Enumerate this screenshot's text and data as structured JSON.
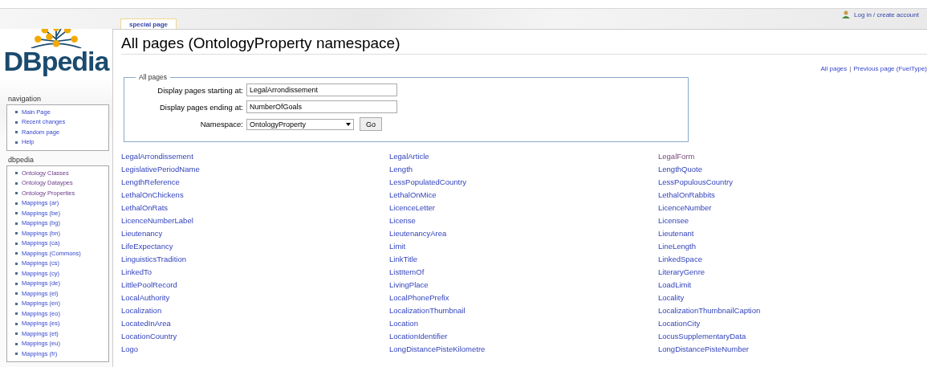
{
  "logo": {
    "text": "DBpedia"
  },
  "user_link": {
    "label": "Log in / create account"
  },
  "tab": {
    "label": "special page",
    "selected": true
  },
  "title": "All pages (OntologyProperty namespace)",
  "nav_links": [
    {
      "label": "All pages"
    },
    {
      "separator": "|"
    },
    {
      "label": "Previous page (FuelType)"
    }
  ],
  "sidebar": [
    {
      "heading": "navigation",
      "items": [
        {
          "label": "Main Page",
          "visited": false
        },
        {
          "label": "Recent changes",
          "visited": false
        },
        {
          "label": "Random page",
          "visited": false
        },
        {
          "label": "Help",
          "visited": false
        }
      ]
    },
    {
      "heading": "dbpedia",
      "items": [
        {
          "label": "Ontology Classes",
          "visited": true
        },
        {
          "label": "Ontology Dataypes",
          "visited": true
        },
        {
          "label": "Ontology Properties",
          "visited": true
        },
        {
          "label": "Mappings (ar)",
          "visited": false
        },
        {
          "label": "Mappings (be)",
          "visited": false
        },
        {
          "label": "Mappings (bg)",
          "visited": false
        },
        {
          "label": "Mappings (bn)",
          "visited": false
        },
        {
          "label": "Mappings (ca)",
          "visited": false
        },
        {
          "label": "Mappings (Commons)",
          "visited": false
        },
        {
          "label": "Mappings (cs)",
          "visited": false
        },
        {
          "label": "Mappings (cy)",
          "visited": false
        },
        {
          "label": "Mappings (de)",
          "visited": false
        },
        {
          "label": "Mappings (el)",
          "visited": false
        },
        {
          "label": "Mappings (en)",
          "visited": false
        },
        {
          "label": "Mappings (eo)",
          "visited": false
        },
        {
          "label": "Mappings (es)",
          "visited": false
        },
        {
          "label": "Mappings (et)",
          "visited": false
        },
        {
          "label": "Mappings (eu)",
          "visited": false
        },
        {
          "label": "Mappings (fr)",
          "visited": false
        }
      ]
    }
  ],
  "form": {
    "legend": "All pages",
    "fields": [
      {
        "kind": "text",
        "label": "Display pages starting at:",
        "value": "LegalArrondissement"
      },
      {
        "kind": "text",
        "label": "Display pages ending at:",
        "value": "NumberOfGoals"
      },
      {
        "kind": "select",
        "label": "Namespace:",
        "value": "OntologyProperty",
        "button": "Go"
      }
    ]
  },
  "page_list": [
    [
      {
        "label": "LegalArrondissement",
        "visited": false
      },
      {
        "label": "LegalArticle",
        "visited": false
      },
      {
        "label": "LegalForm",
        "visited": true
      }
    ],
    [
      {
        "label": "LegislativePeriodName",
        "visited": false
      },
      {
        "label": "Length",
        "visited": false
      },
      {
        "label": "LengthQuote",
        "visited": false
      }
    ],
    [
      {
        "label": "LengthReference",
        "visited": false
      },
      {
        "label": "LessPopulatedCountry",
        "visited": false
      },
      {
        "label": "LessPopulousCountry",
        "visited": false
      }
    ],
    [
      {
        "label": "LethalOnChickens",
        "visited": false
      },
      {
        "label": "LethalOnMice",
        "visited": false
      },
      {
        "label": "LethalOnRabbits",
        "visited": false
      }
    ],
    [
      {
        "label": "LethalOnRats",
        "visited": false
      },
      {
        "label": "LicenceLetter",
        "visited": false
      },
      {
        "label": "LicenceNumber",
        "visited": false
      }
    ],
    [
      {
        "label": "LicenceNumberLabel",
        "visited": false
      },
      {
        "label": "License",
        "visited": false
      },
      {
        "label": "Licensee",
        "visited": false
      }
    ],
    [
      {
        "label": "Lieutenancy",
        "visited": false
      },
      {
        "label": "LieutenancyArea",
        "visited": false
      },
      {
        "label": "Lieutenant",
        "visited": false
      }
    ],
    [
      {
        "label": "LifeExpectancy",
        "visited": false
      },
      {
        "label": "Limit",
        "visited": false
      },
      {
        "label": "LineLength",
        "visited": false
      }
    ],
    [
      {
        "label": "LinguisticsTradition",
        "visited": false
      },
      {
        "label": "LinkTitle",
        "visited": false
      },
      {
        "label": "LinkedSpace",
        "visited": false
      }
    ],
    [
      {
        "label": "LinkedTo",
        "visited": false
      },
      {
        "label": "ListItemOf",
        "visited": false
      },
      {
        "label": "LiteraryGenre",
        "visited": false
      }
    ],
    [
      {
        "label": "LittlePoolRecord",
        "visited": false
      },
      {
        "label": "LivingPlace",
        "visited": false
      },
      {
        "label": "LoadLimit",
        "visited": false
      }
    ],
    [
      {
        "label": "LocalAuthority",
        "visited": false
      },
      {
        "label": "LocalPhonePrefix",
        "visited": false
      },
      {
        "label": "Locality",
        "visited": false
      }
    ],
    [
      {
        "label": "Localization",
        "visited": false
      },
      {
        "label": "LocalizationThumbnail",
        "visited": false
      },
      {
        "label": "LocalizationThumbnailCaption",
        "visited": false
      }
    ],
    [
      {
        "label": "LocatedInArea",
        "visited": false
      },
      {
        "label": "Location",
        "visited": false
      },
      {
        "label": "LocationCity",
        "visited": false
      }
    ],
    [
      {
        "label": "LocationCountry",
        "visited": false
      },
      {
        "label": "LocationIdentifier",
        "visited": false
      },
      {
        "label": "LocusSupplementaryData",
        "visited": false
      }
    ],
    [
      {
        "label": "Logo",
        "visited": false
      },
      {
        "label": "LongDistancePisteKilometre",
        "visited": false
      },
      {
        "label": "LongDistancePisteNumber",
        "visited": false
      }
    ]
  ]
}
